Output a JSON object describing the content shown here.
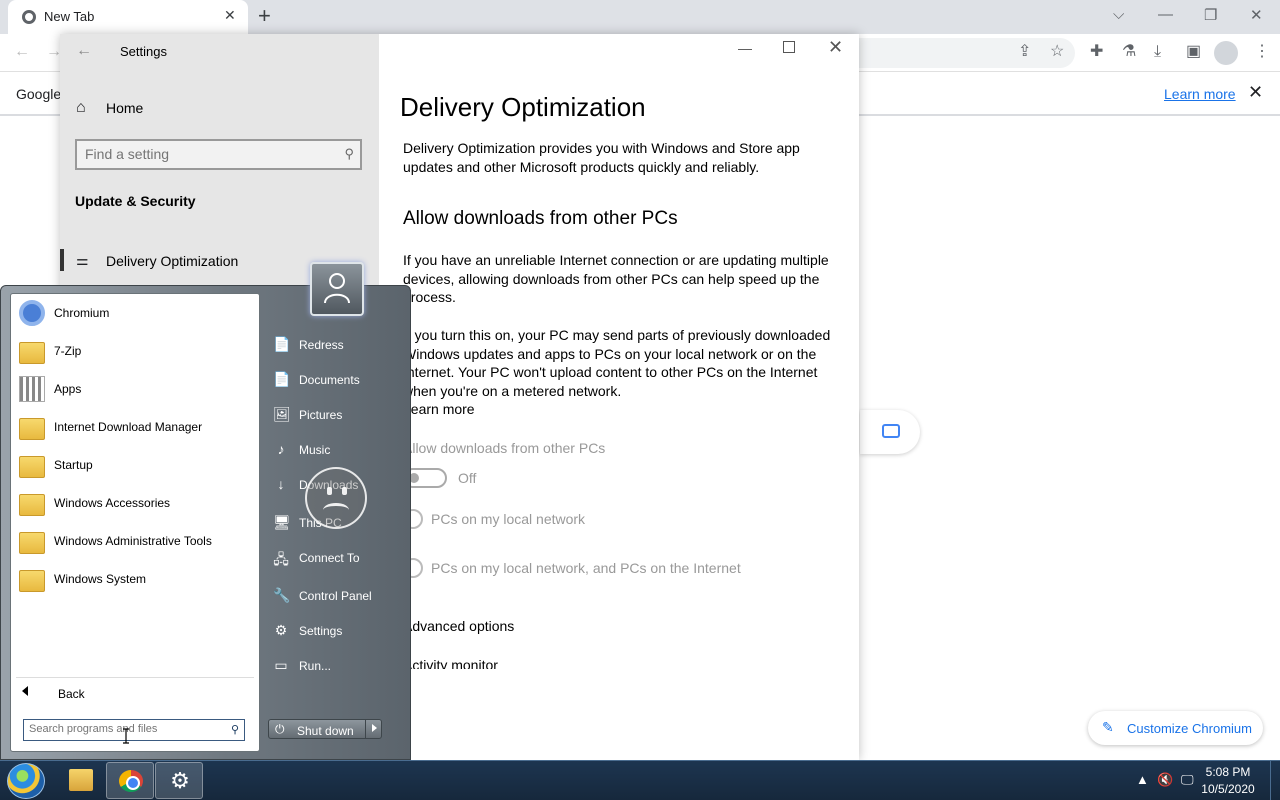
{
  "browser": {
    "tab_title": "New Tab",
    "tab_close": "✕",
    "new_tab": "+",
    "window_controls": {
      "minimize": "—",
      "maximize": "❐",
      "close": "✕",
      "tab_search": "⌵"
    },
    "info_bar": {
      "left_text": "Google",
      "learn_more": "Learn more",
      "close": "✕"
    },
    "customize_label": "Customize Chromium",
    "toolbar_icons": [
      "share-icon",
      "star-icon",
      "extensions-icon",
      "lab-icon",
      "download-icon",
      "side-panel-icon",
      "profile-icon",
      "menu-icon"
    ]
  },
  "settings": {
    "app_title": "Settings",
    "home_label": "Home",
    "search_placeholder": "Find a setting",
    "section_title": "Update & Security",
    "nav_selected": "Delivery Optimization",
    "page_title": "Delivery Optimization",
    "intro": "Delivery Optimization provides you with Windows and Store app updates and other Microsoft products quickly and reliably.",
    "subheading": "Allow downloads from other PCs",
    "para1": "If you have an unreliable Internet connection or are updating multiple devices, allowing downloads from other PCs can help speed up the process.",
    "para2": "If you turn this on, your PC may send parts of previously downloaded Windows updates and apps to PCs on your local network or on the Internet. Your PC won't upload content to other PCs on the Internet when you're on a metered network.",
    "learn_more": "Learn more",
    "toggle_label": "Allow downloads from other PCs",
    "toggle_state": "Off",
    "radio_options": [
      "PCs on my local network",
      "PCs on my local network, and PCs on the Internet"
    ],
    "advanced_options": "Advanced options",
    "activity_monitor": "Activity monitor"
  },
  "start_menu": {
    "programs": [
      {
        "label": "Chromium",
        "icon": "chromium-icon"
      },
      {
        "label": "7-Zip",
        "icon": "folder-icon"
      },
      {
        "label": "Apps",
        "icon": "apps-icon"
      },
      {
        "label": "Internet Download Manager",
        "icon": "folder-icon"
      },
      {
        "label": "Startup",
        "icon": "folder-icon"
      },
      {
        "label": "Windows Accessories",
        "icon": "folder-icon"
      },
      {
        "label": "Windows Administrative Tools",
        "icon": "folder-icon"
      },
      {
        "label": "Windows System",
        "icon": "folder-icon"
      }
    ],
    "back_label": "Back",
    "search_placeholder": "Search programs and files",
    "right_items": [
      {
        "label": "Redress",
        "icon": "📄"
      },
      {
        "label": "Documents",
        "icon": "📄"
      },
      {
        "label": "Pictures",
        "icon": "🖼"
      },
      {
        "label": "Music",
        "icon": "♪"
      },
      {
        "label": "Downloads",
        "icon": "↓"
      },
      {
        "label": "This PC",
        "icon": "🖥"
      },
      {
        "label": "Connect To",
        "icon": "🖧"
      },
      {
        "label": "Control Panel",
        "icon": "🔧"
      },
      {
        "label": "Settings",
        "icon": "⚙"
      },
      {
        "label": "Run...",
        "icon": "▭"
      }
    ],
    "shutdown_label": "Shut down"
  },
  "taskbar": {
    "time": "5:08 PM",
    "date": "10/5/2020",
    "pinned": [
      "file-explorer",
      "chromium",
      "settings"
    ]
  },
  "colors": {
    "link_blue": "#1a73e8",
    "taskbar": "#1d3550"
  }
}
